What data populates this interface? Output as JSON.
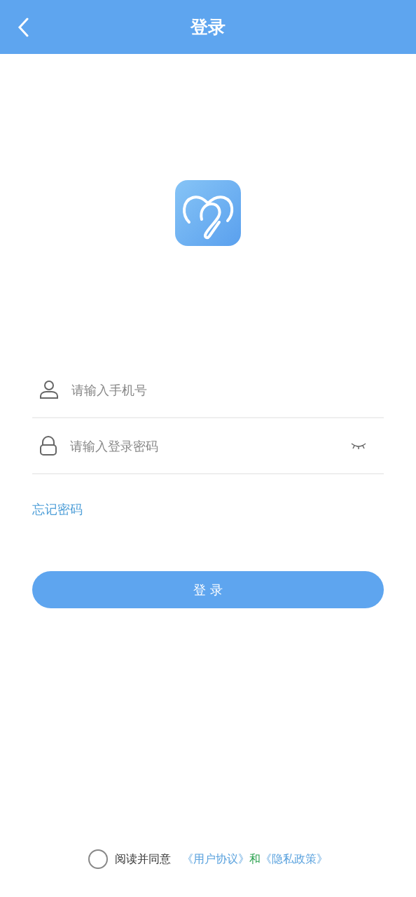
{
  "header": {
    "title": "登录"
  },
  "fields": [
    {
      "kind": "phone",
      "placeholder": "请输入手机号"
    },
    {
      "kind": "password",
      "placeholder": "请输入登录密码",
      "password_hidden": true
    }
  ],
  "forgot_link": "忘记密码",
  "login_button": "登 录",
  "agreement": {
    "checked": false,
    "prefix": "阅读并同意",
    "link_1": "《用户协议》",
    "joiner": "和",
    "link_2": "《隐私政策》"
  }
}
